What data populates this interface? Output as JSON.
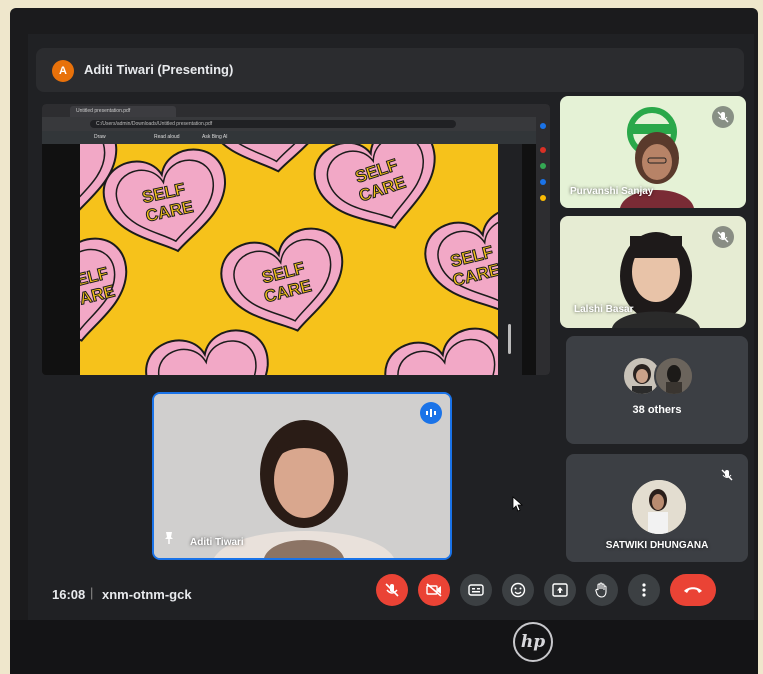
{
  "presenter": {
    "initial": "A",
    "label": "Aditi Tiwari (Presenting)"
  },
  "browser": {
    "tab_title": "Untitled presentation.pdf",
    "address": "C:/Users/admin/Downloads/Untitled presentation.pdf",
    "pdf_toolbar": {
      "draw": "Draw",
      "read_aloud": "Read aloud",
      "ask": "Ask Bing AI"
    }
  },
  "slide": {
    "sticker_text_line1": "SELF",
    "sticker_text_line2": "CARE",
    "background": "#f6c21b",
    "heart_color": "#f2a8c6"
  },
  "participants": [
    {
      "name": "Purvanshi Sanjay",
      "muted": true
    },
    {
      "name": "Lalshi Basar",
      "muted": true
    }
  ],
  "others": {
    "label": "38 others"
  },
  "satwiki": {
    "name": "SATWIKI DHUNGANA",
    "muted": true
  },
  "self": {
    "name": "Aditi Tiwari",
    "pin_icon": "pin-icon"
  },
  "meeting": {
    "time": "16:08",
    "separator": "|",
    "code": "xnm-otnm-gck"
  },
  "controls": [
    {
      "id": "mic",
      "icon": "mic-off-icon",
      "state": "off"
    },
    {
      "id": "camera",
      "icon": "camera-off-icon",
      "state": "off"
    },
    {
      "id": "captions",
      "icon": "captions-icon"
    },
    {
      "id": "emoji",
      "icon": "emoji-icon"
    },
    {
      "id": "present",
      "icon": "present-icon"
    },
    {
      "id": "hand",
      "icon": "raise-hand-icon"
    },
    {
      "id": "more",
      "icon": "more-options-icon"
    },
    {
      "id": "leave",
      "icon": "end-call-icon"
    }
  ],
  "brand": {
    "logo_text": "hp"
  },
  "colors": {
    "danger": "#ea4335",
    "accent": "#1a73e8",
    "surface": "#202124"
  }
}
